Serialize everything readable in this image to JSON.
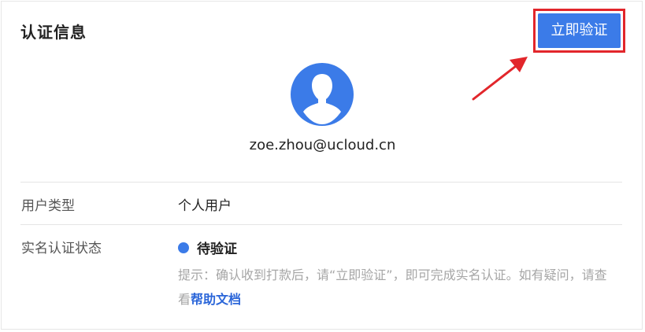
{
  "header": {
    "title": "认证信息",
    "verify_button": "立即验证"
  },
  "profile": {
    "email": "zoe.zhou@ucloud.cn",
    "avatar_icon": "user-avatar-icon"
  },
  "fields": {
    "user_type_label": "用户类型",
    "user_type_value": "个人用户",
    "status_label": "实名认证状态",
    "status_value": "待验证",
    "hint_text": "提示：确认收到打款后，请“立即验证”，即可完成实名认证。如有疑问，请查看",
    "help_link": "帮助文档"
  },
  "colors": {
    "accent": "#3b7be8",
    "highlight_border": "#e2262b",
    "hint": "#a6a6a6",
    "link": "#2b66d9"
  }
}
